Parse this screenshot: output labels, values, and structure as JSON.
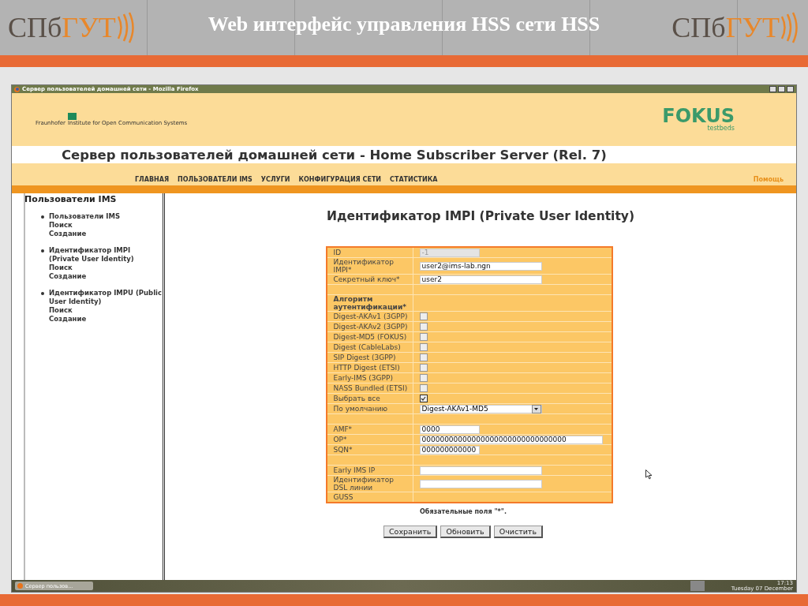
{
  "slide": {
    "logo_left": {
      "part1": "СПб",
      "part2": "ГУТ"
    },
    "title": "Web интерфейс управления HSS сети HSS",
    "logo_right": {
      "part1": "СПб",
      "part2": "ГУТ"
    }
  },
  "window": {
    "title": "Сервер пользователей домашней сети - Mozilla Firefox"
  },
  "header": {
    "org": "Fraunhofer",
    "institute": "Institute for Open Communication Systems",
    "brand": "FOKUS",
    "brand_sub": "testbeds"
  },
  "page_title": "Сервер пользователей домашней сети - Home Subscriber Server (Rel. 7)",
  "nav": {
    "items": [
      {
        "label": "ГЛАВНАЯ"
      },
      {
        "label": "ПОЛЬЗОВАТЕЛИ IMS"
      },
      {
        "label": "УСЛУГИ"
      },
      {
        "label": "КОНФИГУРАЦИЯ СЕТИ"
      },
      {
        "label": "СТАТИСТИКА"
      }
    ],
    "help": "Помощь"
  },
  "sidebar": {
    "heading": "Пользователи IMS",
    "groups": [
      {
        "title": "Пользователи IMS",
        "links": [
          "Поиск",
          "Создание"
        ]
      },
      {
        "title": "Идентификатор IMPI (Private User Identity)",
        "links": [
          "Поиск",
          "Создание"
        ]
      },
      {
        "title": "Идентификатор IMPU (Public User Identity)",
        "links": [
          "Поиск",
          "Создание"
        ]
      }
    ]
  },
  "content": {
    "heading": "Идентификатор IMPI (Private User Identity)",
    "form": [
      {
        "kind": "short_text",
        "label": "ID",
        "value": "-1",
        "disabled": true
      },
      {
        "kind": "text",
        "label": "Идентификатор IMPI*",
        "value": "user2@ims-lab.ngn",
        "disabled": false
      },
      {
        "kind": "text",
        "label": "Секретный ключ*",
        "value": "user2",
        "disabled": false
      },
      {
        "kind": "spacer"
      },
      {
        "kind": "section",
        "label": "Алгоритм аутентификации*"
      },
      {
        "kind": "checkbox",
        "label": "Digest-AKAv1 (3GPP)",
        "checked": false
      },
      {
        "kind": "checkbox",
        "label": "Digest-AKAv2 (3GPP)",
        "checked": false
      },
      {
        "kind": "checkbox",
        "label": "Digest-MD5 (FOKUS)",
        "checked": false
      },
      {
        "kind": "checkbox",
        "label": "Digest (CableLabs)",
        "checked": false
      },
      {
        "kind": "checkbox",
        "label": "SIP Digest (3GPP)",
        "checked": false
      },
      {
        "kind": "checkbox",
        "label": "HTTP Digest (ETSI)",
        "checked": false
      },
      {
        "kind": "checkbox",
        "label": "Early-IMS (3GPP)",
        "checked": false
      },
      {
        "kind": "checkbox",
        "label": "NASS Bundled (ETSI)",
        "checked": false
      },
      {
        "kind": "checkbox",
        "label": "Выбрать все",
        "checked": true
      },
      {
        "kind": "select",
        "label": "По умолчанию",
        "value": "Digest-AKAv1-MD5"
      },
      {
        "kind": "spacer"
      },
      {
        "kind": "short_text",
        "label": "AMF*",
        "value": "0000",
        "disabled": false
      },
      {
        "kind": "long_text",
        "label": "OP*",
        "value": "00000000000000000000000000000000",
        "disabled": false
      },
      {
        "kind": "short_text",
        "label": "SQN*",
        "value": "000000000000",
        "disabled": false
      },
      {
        "kind": "spacer"
      },
      {
        "kind": "text",
        "label": "Early IMS IP",
        "disabled": false
      },
      {
        "kind": "text",
        "label": "Идентификатор DSL линии",
        "disabled": false
      },
      {
        "kind": "static",
        "label": "GUSS"
      }
    ],
    "note": "Обязательные поля \"*\".",
    "buttons": [
      "Сохранить",
      "Обновить",
      "Очистить"
    ]
  },
  "taskbar": {
    "item": "Сервер пользов...",
    "time": "17:13",
    "date": "Tuesday 07 December"
  }
}
